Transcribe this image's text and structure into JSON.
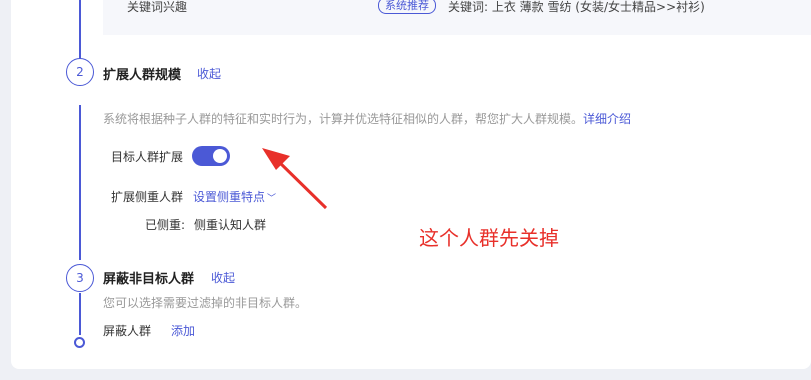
{
  "prev_section": {
    "label": "关键词兴趣",
    "tag": "系统推荐",
    "keywords": "关键词: 上衣 薄款 雪纺 (女装/女士精品>>衬衫)"
  },
  "step2": {
    "number": "2",
    "title": "扩展人群规模",
    "collapse": "收起",
    "description": "系统将根据种子人群的特征和实时行为，计算并优选特征相似的人群，帮您扩大人群规模。",
    "detail_link": "详细介绍",
    "toggle_label": "目标人群扩展",
    "toggle_on": true,
    "focus_label": "扩展侧重人群",
    "focus_link": "设置侧重特点",
    "focused_label": "已侧重:",
    "focused_value": "侧重认知人群"
  },
  "annotation": {
    "text": "这个人群先关掉",
    "color": "#e8302a"
  },
  "step3": {
    "number": "3",
    "title": "屏蔽非目标人群",
    "collapse": "收起",
    "description": "您可以选择需要过滤掉的非目标人群。",
    "field_label": "屏蔽人群",
    "add_link": "添加"
  },
  "colors": {
    "accent": "#4b59d6",
    "annotation": "#e8302a"
  }
}
